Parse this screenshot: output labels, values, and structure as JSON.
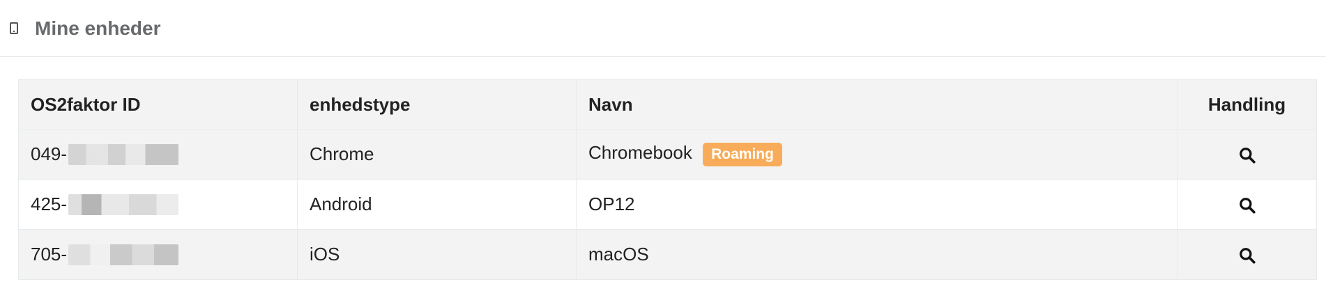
{
  "header": {
    "icon": "mobile-phone-icon",
    "title": "Mine enheder"
  },
  "table": {
    "columns": [
      "OS2faktor ID",
      "enhedstype",
      "Navn",
      "Handling"
    ],
    "rows": [
      {
        "id_prefix": "049-",
        "type": "Chrome",
        "name": "Chromebook",
        "badge": "Roaming",
        "action_icon": "search-icon"
      },
      {
        "id_prefix": "425-",
        "type": "Android",
        "name": "OP12",
        "badge": "",
        "action_icon": "search-icon"
      },
      {
        "id_prefix": "705-",
        "type": "iOS",
        "name": "macOS",
        "badge": "",
        "action_icon": "search-icon"
      }
    ]
  },
  "colors": {
    "badge": "#f8ac59",
    "header_bg": "#f3f3f3",
    "title": "#676a6c"
  }
}
